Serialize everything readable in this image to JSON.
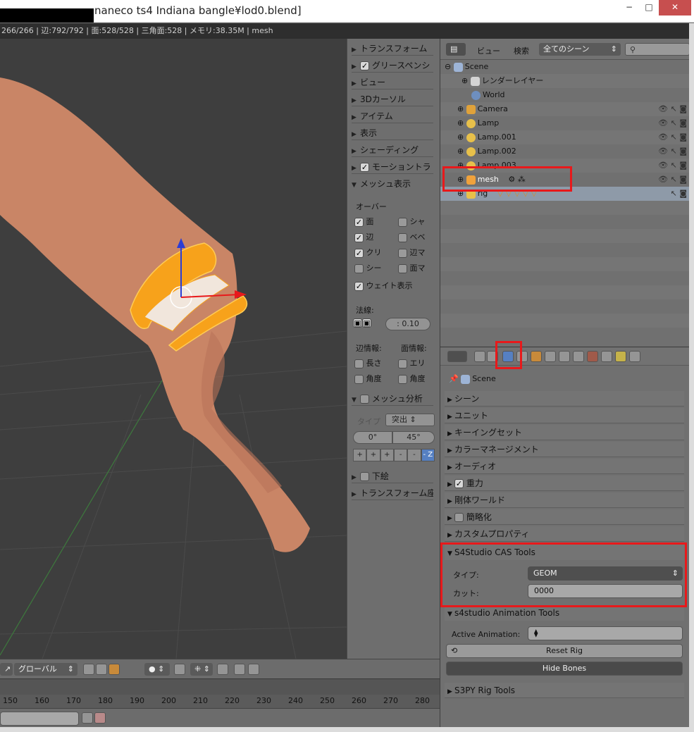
{
  "window": {
    "title": "naneco ts4 Indiana bangle¥lod0.blend]",
    "minimize": "−",
    "maximize": "□",
    "close": "✕"
  },
  "infobar": {
    "text": "266/266 | 辺:792/792 | 面:528/528 | 三角面:528 | メモリ:38.35M | mesh"
  },
  "npanel": {
    "headers": [
      "トランスフォーム",
      "グリースペンシ",
      "ビュー",
      "3Dカーソル",
      "アイテム",
      "表示",
      "シェーディング",
      "モーショントラ"
    ],
    "mesh_display": {
      "title": "メッシュ表示",
      "overlay_label": "オーバー",
      "left": [
        "面",
        "辺",
        "クリ",
        "シー"
      ],
      "right": [
        "シャ",
        "ベベ",
        "辺マ",
        "面マ"
      ],
      "weight": "ウェイト表示",
      "normal_label": "法線:",
      "normal_value": "0.10",
      "edge_info": "辺情報:",
      "face_info": "面情報:",
      "length": "長さ",
      "area": "エリ",
      "angle": "角度",
      "angle2": "角度"
    },
    "mesh_analysis": {
      "title": "メッシュ分析",
      "type_label": "タイプ",
      "type_value": "突出",
      "min": "0°",
      "max": "45°",
      "axes": [
        "+",
        "+",
        "+",
        "-",
        "-",
        "- Z"
      ]
    },
    "background": "下絵",
    "transform_orient": "トランスフォーム座"
  },
  "outliner": {
    "view": "ビュー",
    "search": "検索",
    "scene_select": "全てのシーン",
    "rows": [
      {
        "label": "Scene",
        "indent": 1
      },
      {
        "label": "レンダーレイヤー",
        "indent": 2
      },
      {
        "label": "World",
        "indent": 2
      },
      {
        "label": "Camera",
        "indent": 2
      },
      {
        "label": "Lamp",
        "indent": 2
      },
      {
        "label": "Lamp.001",
        "indent": 2
      },
      {
        "label": "Lamp.002",
        "indent": 2
      },
      {
        "label": "Lamp.003",
        "indent": 2
      },
      {
        "label": "mesh",
        "indent": 2
      },
      {
        "label": "rig",
        "indent": 2
      }
    ]
  },
  "properties": {
    "context": "Scene",
    "panels": [
      "シーン",
      "ユニット",
      "キーイングセット",
      "カラーマネージメント",
      "オーディオ",
      "重力",
      "剛体ワールド",
      "簡略化",
      "カスタムプロパティ"
    ],
    "cas_tools": {
      "title": "S4Studio CAS Tools",
      "type_label": "タイプ:",
      "type_value": "GEOM",
      "cut_label": "カット:",
      "cut_value": "0000"
    },
    "anim_tools": {
      "title": "s4studio Animation Tools",
      "active_label": "Active Animation:",
      "reset_rig": "Reset Rig",
      "hide_bones": "Hide Bones"
    },
    "s3py": "S3PY Rig Tools"
  },
  "bottom": {
    "orientation": "グローバル",
    "ticks": [
      "150",
      "160",
      "170",
      "180",
      "190",
      "200",
      "210",
      "220",
      "230",
      "240",
      "250",
      "260",
      "270",
      "280"
    ]
  },
  "colors": {
    "highlight": "#e8191b",
    "selection": "#f7a21b",
    "active_tab": "#5680c2"
  }
}
